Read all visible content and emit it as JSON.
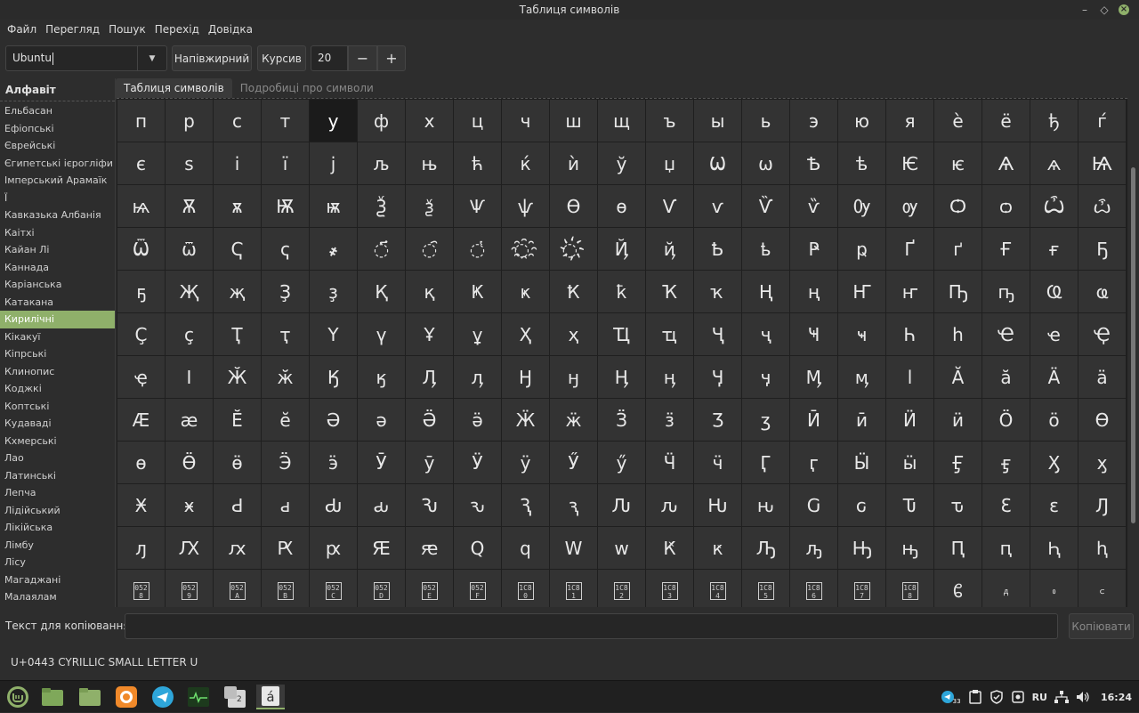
{
  "window": {
    "title": "Таблиця символів"
  },
  "menu": [
    "Файл",
    "Перегляд",
    "Пошук",
    "Перехід",
    "Довідка"
  ],
  "toolbar": {
    "font": "Ubuntu",
    "bold": "Напівжирний",
    "italic": "Курсив",
    "size": "20",
    "minus": "−",
    "plus": "+"
  },
  "sidebar": {
    "header": "Алфавіт",
    "items": [
      "Ельбасан",
      "Ефіопські",
      "Єврейські",
      "Єгипетські ієрогліфи",
      "Імперський Арамаїк",
      "Ї",
      "Кавказька Албанія",
      "Каітхі",
      "Кайан Лі",
      "Каннада",
      "Каріанська",
      "Катакана",
      "Кирилічні",
      "Кікакуї",
      "Кіпрські",
      "Клинопис",
      "Коджкі",
      "Коптські",
      "Кудаваді",
      "Кхмерські",
      "Лао",
      "Латинські",
      "Лепча",
      "Лідійський",
      "Лікійська",
      "Лімбу",
      "Лісу",
      "Магаджані",
      "Малаялам"
    ],
    "selected": 12
  },
  "tabs": [
    "Таблиця символів",
    "Подробиці про символи"
  ],
  "grid": [
    "п",
    "р",
    "с",
    "т",
    "у",
    "ф",
    "х",
    "ц",
    "ч",
    "ш",
    "щ",
    "ъ",
    "ы",
    "ь",
    "э",
    "ю",
    "я",
    "ѐ",
    "ё",
    "ђ",
    "ѓ",
    "є",
    "ѕ",
    "і",
    "ї",
    "ј",
    "љ",
    "њ",
    "ћ",
    "ќ",
    "ѝ",
    "ў",
    "џ",
    "Ѡ",
    "ѡ",
    "Ѣ",
    "ѣ",
    "Ѥ",
    "ѥ",
    "Ѧ",
    "ѧ",
    "Ѩ",
    "ѩ",
    "Ѫ",
    "ѫ",
    "Ѭ",
    "ѭ",
    "Ѯ",
    "ѯ",
    "Ѱ",
    "ѱ",
    "Ѳ",
    "ѳ",
    "Ѵ",
    "ѵ",
    "Ѷ",
    "ѷ",
    "Ѹ",
    "ѹ",
    "Ѻ",
    "ѻ",
    "Ѽ",
    "ѽ",
    "Ѿ",
    "ѿ",
    "Ҁ",
    "ҁ",
    "҂",
    "◌҃",
    "◌҄",
    "◌҅",
    "◌҈",
    "◌҉",
    "Ҋ",
    "ҋ",
    "Ҍ",
    "ҍ",
    "Ҏ",
    "ҏ",
    "Ґ",
    "ґ",
    "Ғ",
    "ғ",
    "Ҕ",
    "ҕ",
    "Җ",
    "җ",
    "Ҙ",
    "ҙ",
    "Қ",
    "қ",
    "Ҝ",
    "ҝ",
    "Ҟ",
    "ҟ",
    "Ҡ",
    "ҡ",
    "Ң",
    "ң",
    "Ҥ",
    "ҥ",
    "Ҧ",
    "ҧ",
    "Ҩ",
    "ҩ",
    "Ҫ",
    "ҫ",
    "Ҭ",
    "ҭ",
    "Ү",
    "ү",
    "Ұ",
    "ұ",
    "Ҳ",
    "ҳ",
    "Ҵ",
    "ҵ",
    "Ҷ",
    "ҷ",
    "Ҹ",
    "ҹ",
    "Һ",
    "һ",
    "Ҽ",
    "ҽ",
    "Ҿ",
    "ҿ",
    "Ӏ",
    "Ӂ",
    "ӂ",
    "Ӄ",
    "ӄ",
    "Ӆ",
    "ӆ",
    "Ӈ",
    "ӈ",
    "Ӊ",
    "ӊ",
    "Ӌ",
    "ӌ",
    "Ӎ",
    "ӎ",
    "ӏ",
    "Ӑ",
    "ӑ",
    "Ӓ",
    "ӓ",
    "Ӕ",
    "ӕ",
    "Ӗ",
    "ӗ",
    "Ә",
    "ә",
    "Ӛ",
    "ӛ",
    "Ӝ",
    "ӝ",
    "Ӟ",
    "ӟ",
    "Ӡ",
    "ӡ",
    "Ӣ",
    "ӣ",
    "Ӥ",
    "ӥ",
    "Ӧ",
    "ӧ",
    "Ө",
    "ө",
    "Ӫ",
    "ӫ",
    "Ӭ",
    "ӭ",
    "Ӯ",
    "ӯ",
    "Ӱ",
    "ӱ",
    "Ӳ",
    "ӳ",
    "Ӵ",
    "ӵ",
    "Ӷ",
    "ӷ",
    "Ӹ",
    "ӹ",
    "Ӻ",
    "ӻ",
    "Ӽ",
    "ӽ",
    "Ӿ",
    "ӿ",
    "Ԁ",
    "ԁ",
    "Ԃ",
    "ԃ",
    "Ԅ",
    "ԅ",
    "Ԇ",
    "ԇ",
    "Ԉ",
    "ԉ",
    "Ԋ",
    "ԋ",
    "Ԍ",
    "ԍ",
    "Ԏ",
    "ԏ",
    "Ԑ",
    "ԑ",
    "Ԓ",
    "ԓ",
    "Ԕ",
    "ԕ",
    "Ԗ",
    "ԗ",
    "Ԙ",
    "ԙ",
    "Ԛ",
    "ԛ",
    "Ԝ",
    "ԝ",
    "Ԟ",
    "ԟ",
    "Ԡ",
    "ԡ",
    "Ԣ",
    "ԣ",
    "Ԥ",
    "ԥ",
    "Ԧ",
    "ԧ",
    "052\n8",
    "052\n9",
    "052\nA",
    "052\nB",
    "052\nC",
    "052\nD",
    "052\nE",
    "052\nF",
    "1C8\n0",
    "1C8\n1",
    "1C8\n2",
    "1C8\n3",
    "1C8\n4",
    "1C8\n5",
    "1C8\n6",
    "1C8\n7",
    "1C8\n8",
    "ᲀ",
    "ᲁ",
    "ᲂ",
    "ᲃ"
  ],
  "selected_index": 4,
  "copy": {
    "label": "Текст для копіювання:",
    "value": "",
    "button": "Копіювати"
  },
  "status": "U+0443 CYRILLIC SMALL LETTER U",
  "taskbar": {
    "apps": [
      "mint-menu-icon",
      "files-icon",
      "folder-icon",
      "firefox-icon",
      "telegram-icon",
      "system-monitor-icon",
      "workspace-switcher-icon",
      "charmap-icon"
    ],
    "badge": "2",
    "tray_lang": "RU",
    "telegram_count": "33",
    "clock": "16:24"
  },
  "colors": {
    "accent": "#8fb06a",
    "background": "#2d2d2d",
    "cell": "#333333",
    "cell_selected": "#1b1b1b"
  }
}
